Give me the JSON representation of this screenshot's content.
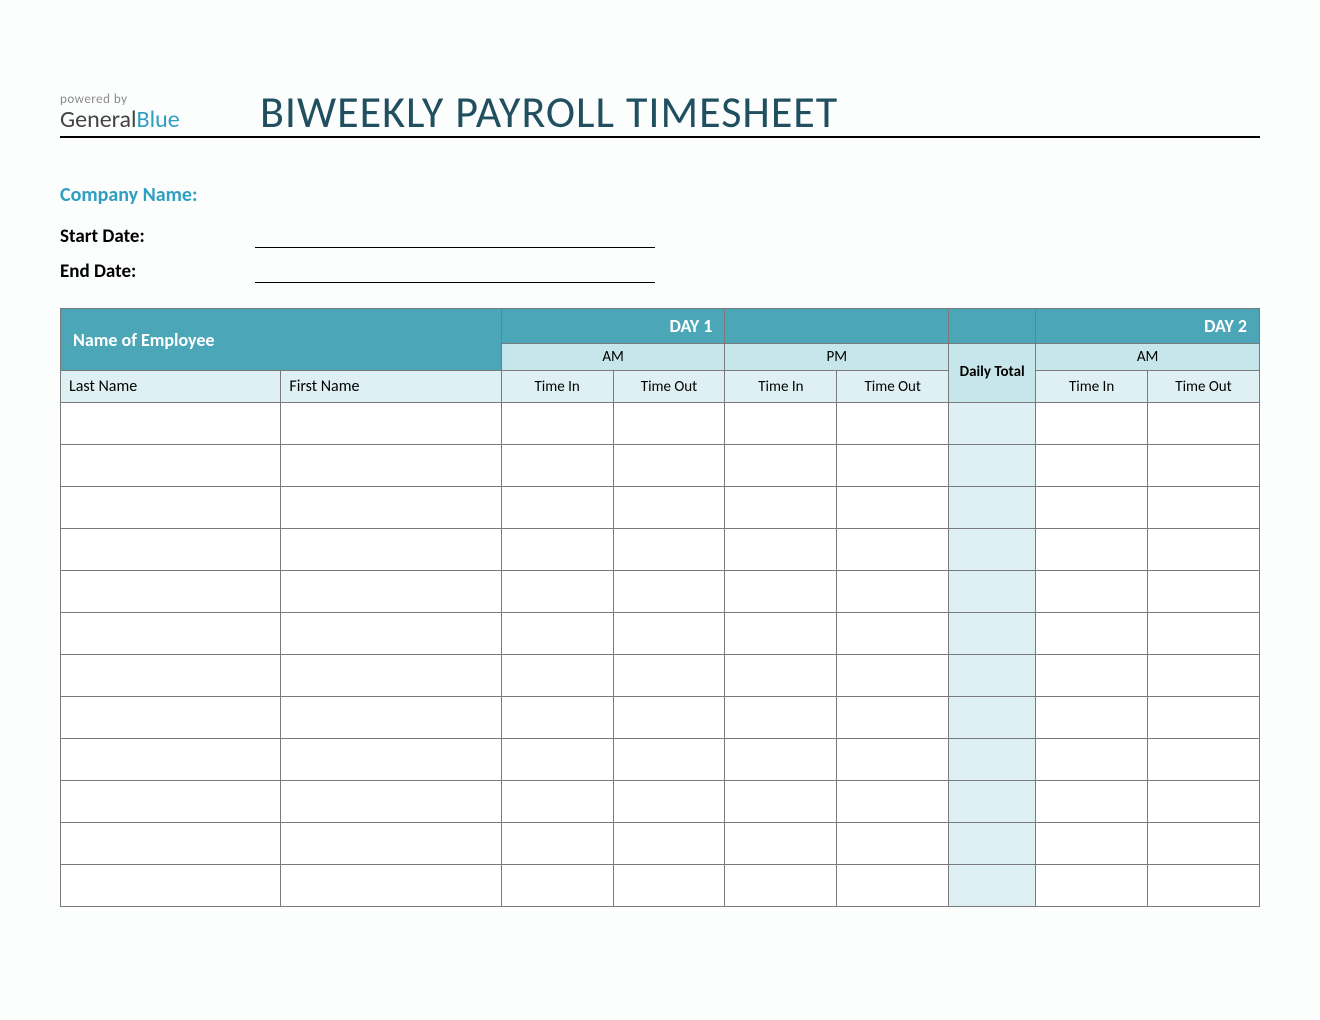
{
  "header": {
    "powered_by": "powered by",
    "logo_general": "General",
    "logo_blue": "Blue",
    "title": "BIWEEKLY PAYROLL TIMESHEET"
  },
  "meta": {
    "company_label": "Company Name:",
    "start_label": "Start Date:",
    "end_label": "End Date:",
    "start_value": "",
    "end_value": ""
  },
  "table": {
    "name_header": "Name of Employee",
    "day1": "DAY 1",
    "day2": "DAY 2",
    "am": "AM",
    "pm": "PM",
    "daily_total": "Daily Total",
    "last_name": "Last Name",
    "first_name": "First Name",
    "time_in": "Time In",
    "time_out": "Time Out"
  },
  "rows": 12
}
